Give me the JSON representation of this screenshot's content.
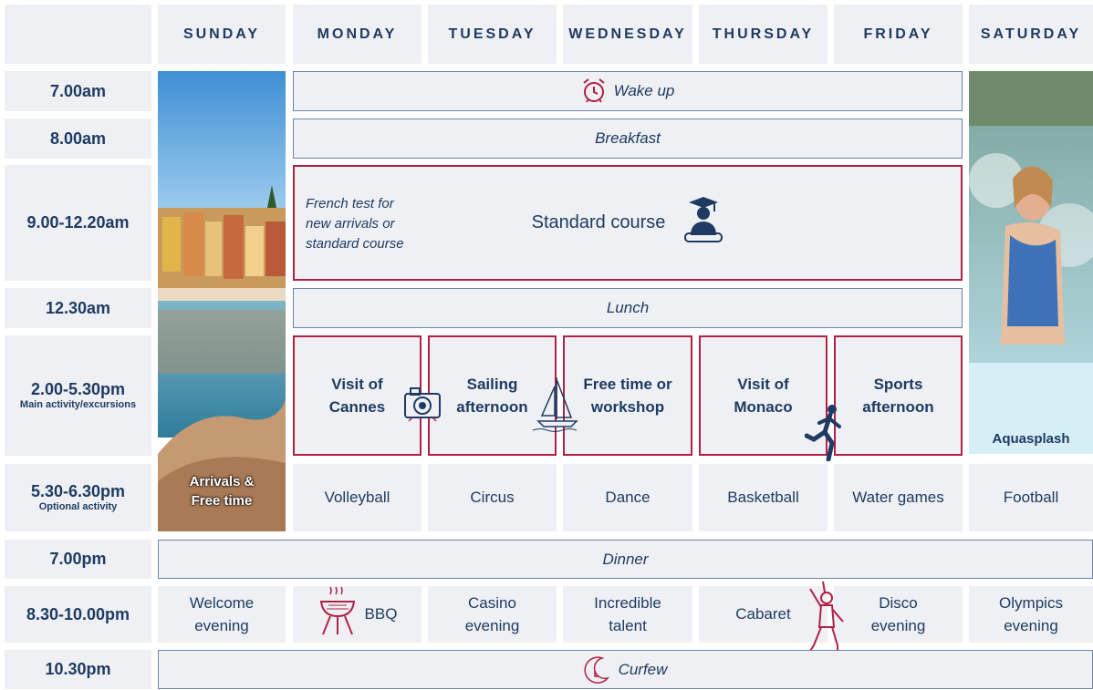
{
  "days": [
    "SUNDAY",
    "MONDAY",
    "TUESDAY",
    "WEDNESDAY",
    "THURSDAY",
    "FRIDAY",
    "SATURDAY"
  ],
  "times": {
    "t1": {
      "main": "7.00am"
    },
    "t2": {
      "main": "8.00am"
    },
    "t3": {
      "main": "9.00-12.20am"
    },
    "t4": {
      "main": "12.30am"
    },
    "t5": {
      "main": "2.00-5.30pm",
      "sub": "Main activity/excursions"
    },
    "t6": {
      "main": "5.30-6.30pm",
      "sub": "Optional activity"
    },
    "t7": {
      "main": "7.00pm"
    },
    "t8": {
      "main": "8.30-10.00pm"
    },
    "t9": {
      "main": "10.30pm"
    }
  },
  "bands": {
    "wakeup": "Wake up",
    "breakfast": "Breakfast",
    "lunch": "Lunch",
    "dinner": "Dinner",
    "curfew": "Curfew"
  },
  "morning": {
    "note": "French test for\nnew arrivals or\nstandard course",
    "course": "Standard course"
  },
  "excursions": [
    "Visit of\nCannes",
    "Sailing\nafternoon",
    "Free time or\nworkshop",
    "Visit of\nMonaco",
    "Sports\nafternoon"
  ],
  "sunday_label": "Arrivals &\nFree time",
  "saturday_label": "Aquasplash",
  "optional": [
    "Volleyball",
    "Circus",
    "Dance",
    "Basketball",
    "Water games",
    "Football"
  ],
  "evening": [
    "Welcome\nevening",
    "BBQ",
    "Casino\nevening",
    "Incredible\ntalent",
    "Cabaret",
    "Disco\nevening",
    "Olympics\nevening"
  ],
  "colors": {
    "navy": "#1f3b63",
    "accent": "#b32045",
    "cell": "#eef0f3",
    "band_border": "#6c86a6"
  },
  "icons": [
    "alarm-clock-icon",
    "graduate-icon",
    "camera-icon",
    "sailboat-icon",
    "runner-icon",
    "bbq-grill-icon",
    "dancer-icon",
    "moon-clock-icon"
  ]
}
